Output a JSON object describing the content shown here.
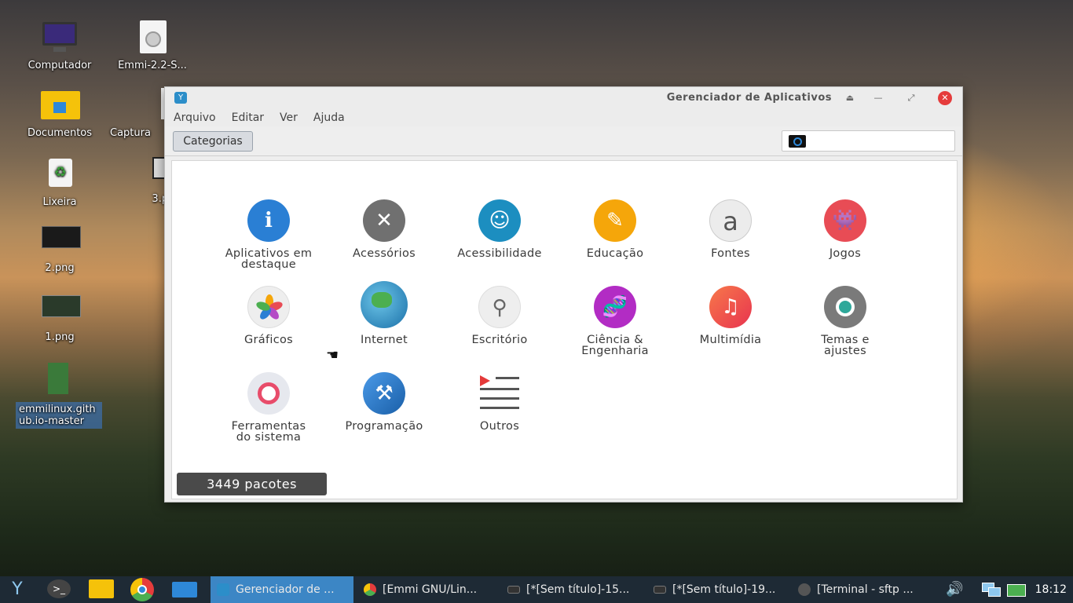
{
  "desktop": {
    "icons": [
      {
        "label": "Computador"
      },
      {
        "label": "Emmi-2.2-S..."
      },
      {
        "label": "Documentos"
      },
      {
        "label": "Captura"
      },
      {
        "label": "Lixeira"
      },
      {
        "label": "3.png"
      },
      {
        "label": "2.png"
      },
      {
        "label": "1.png"
      },
      {
        "label": "emmilinux.github.io-master"
      }
    ]
  },
  "window": {
    "title": "Gerenciador de Aplicativos",
    "menu": [
      "Arquivo",
      "Editar",
      "Ver",
      "Ajuda"
    ],
    "categories_button": "Categorias",
    "search": {
      "value": "",
      "placeholder": ""
    },
    "categories": [
      {
        "label": "Aplicativos em destaque",
        "icon": "info-icon"
      },
      {
        "label": "Acessórios",
        "icon": "tools-icon"
      },
      {
        "label": "Acessibilidade",
        "icon": "accessibility-icon"
      },
      {
        "label": "Educação",
        "icon": "education-icon"
      },
      {
        "label": "Fontes",
        "icon": "fonts-icon"
      },
      {
        "label": "Jogos",
        "icon": "games-icon"
      },
      {
        "label": "Gráficos",
        "icon": "graphics-icon"
      },
      {
        "label": "Internet",
        "icon": "internet-icon"
      },
      {
        "label": "Escritório",
        "icon": "office-icon"
      },
      {
        "label": "Ciência & Engenharia",
        "icon": "science-icon"
      },
      {
        "label": "Multimídia",
        "icon": "multimedia-icon"
      },
      {
        "label": "Temas e ajustes",
        "icon": "themes-icon"
      },
      {
        "label": "Ferramentas do sistema",
        "icon": "system-tools-icon"
      },
      {
        "label": "Programação",
        "icon": "programming-icon"
      },
      {
        "label": "Outros",
        "icon": "others-icon"
      }
    ],
    "status": "3449 pacotes"
  },
  "taskbar": {
    "tasks": [
      {
        "label": "Gerenciador de ..."
      },
      {
        "label": "[Emmi GNU/Lin..."
      },
      {
        "label": "[*[Sem título]-15..."
      },
      {
        "label": "[*[Sem título]-19..."
      },
      {
        "label": "[Terminal - sftp ..."
      }
    ],
    "clock": "18:12"
  },
  "colors": {
    "accent": "#3c86c5",
    "taskbar": "#1e2a35",
    "close": "#e53c3c"
  }
}
